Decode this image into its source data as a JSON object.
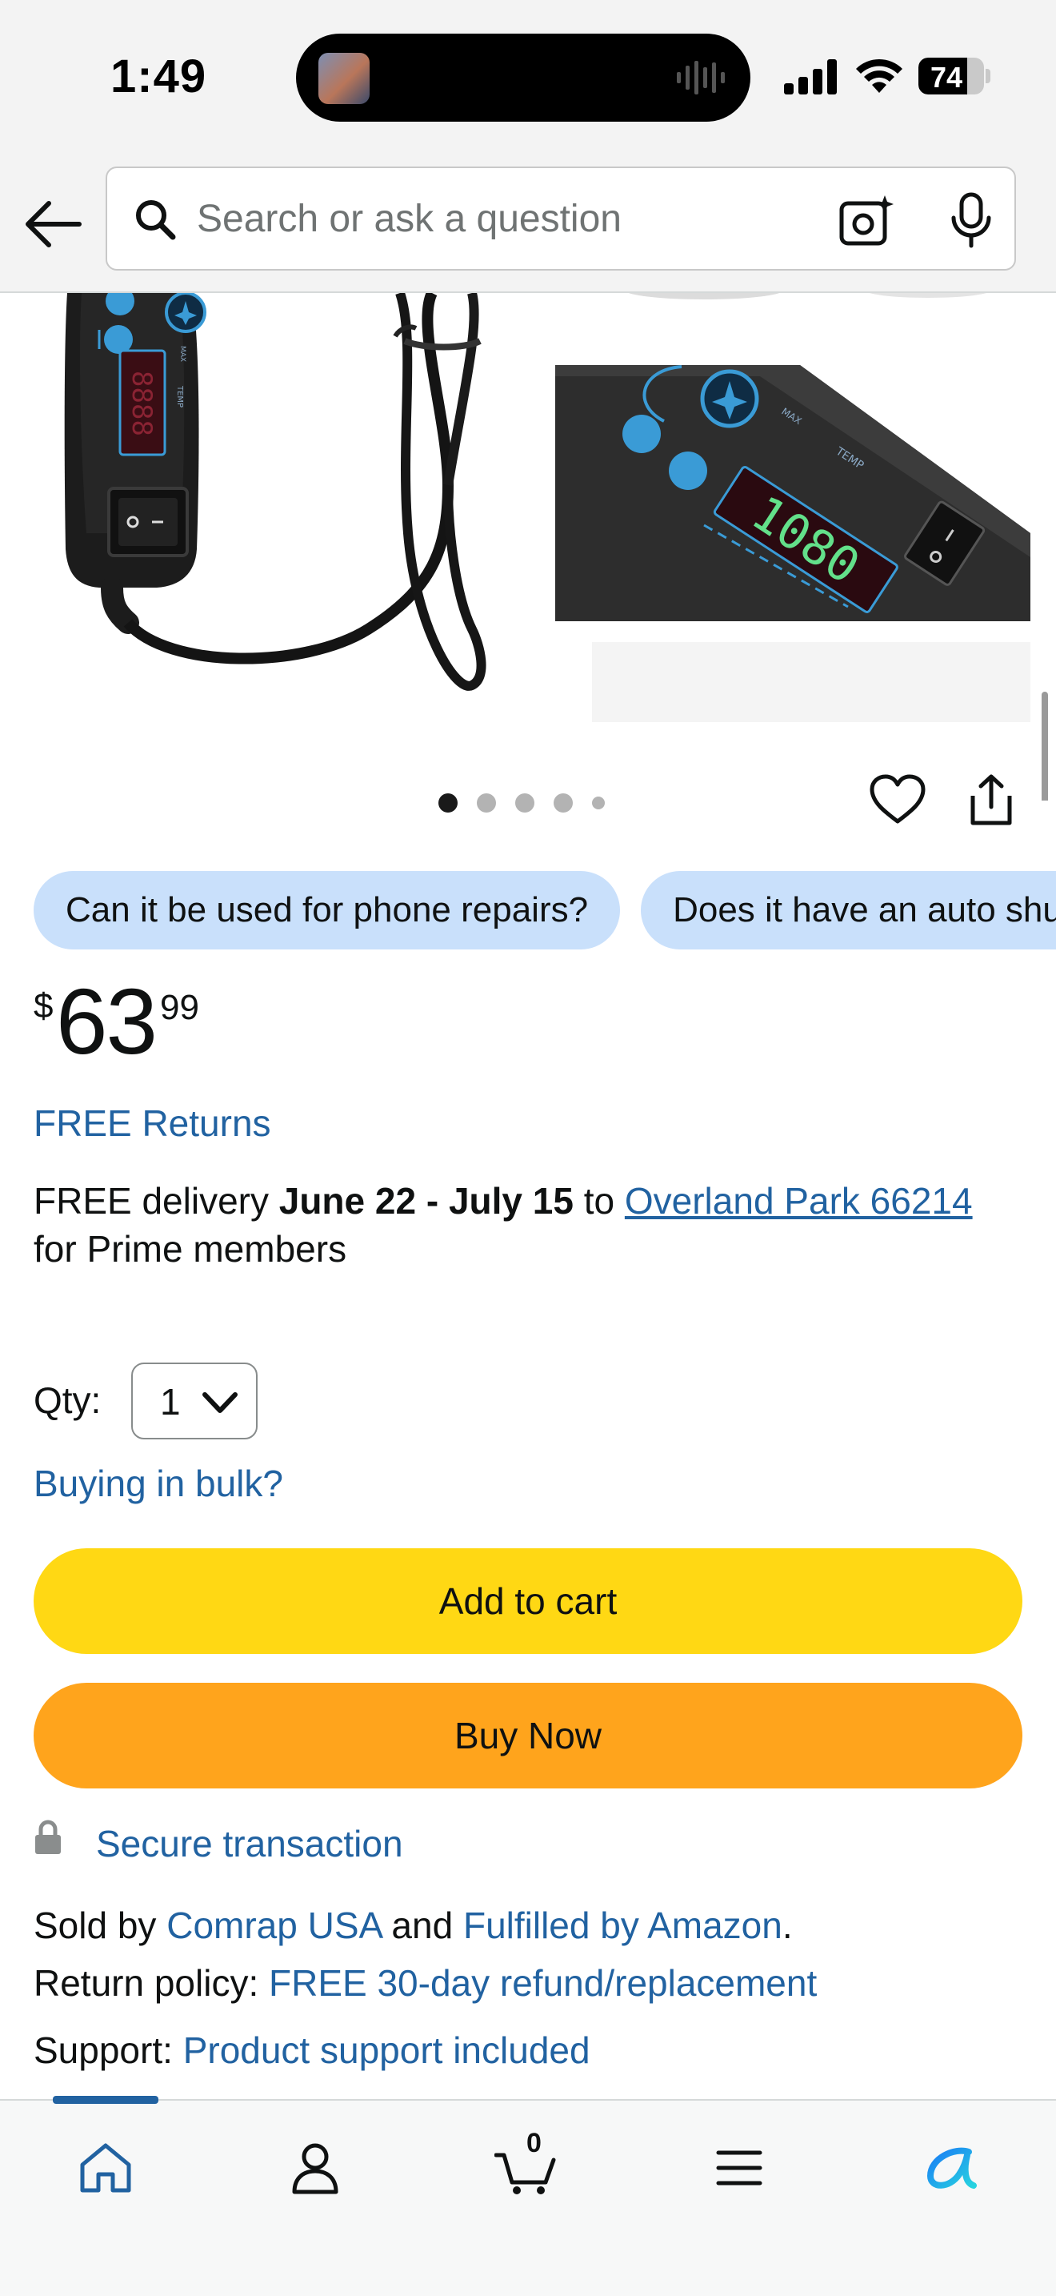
{
  "status_bar": {
    "time": "1:49",
    "battery_level": 74,
    "battery_text": "74"
  },
  "header": {
    "search_placeholder": "Search or ask a question",
    "icons": [
      "back-arrow-icon",
      "search-icon",
      "camera-lens-icon",
      "mic-icon"
    ]
  },
  "gallery": {
    "image_count": 5,
    "active_index": 0,
    "display_reading": "1080"
  },
  "questions": [
    "Can it be used for phone repairs?",
    "Does it have an auto shut-off?"
  ],
  "price": {
    "symbol": "$",
    "whole": "63",
    "fraction": "99"
  },
  "returns": {
    "label": "FREE Returns"
  },
  "delivery": {
    "prefix": "FREE delivery ",
    "dates": "June 22 - July 15",
    "middle": " to ",
    "location": "Overland Park 66214",
    "suffix": "for Prime members"
  },
  "quantity": {
    "label": "Qty:",
    "value": "1"
  },
  "bulk_link": "Buying in bulk?",
  "buttons": {
    "add_to_cart": "Add to cart",
    "buy_now": "Buy Now"
  },
  "secure": {
    "label": "Secure transaction"
  },
  "seller": {
    "sold_by_label": "Sold by ",
    "seller_name": "Comrap USA",
    "and": " and ",
    "fulfilled": "Fulfilled by Amazon",
    "period": ".",
    "return_label": "Return policy: ",
    "return_value": "FREE 30-day refund/replacement",
    "support_label": "Support: ",
    "support_value": "Product support included"
  },
  "bottom_nav": {
    "cart_count": "0",
    "active": "home",
    "items": [
      "home-icon",
      "account-icon",
      "cart-icon",
      "menu-icon",
      "rufus-icon"
    ]
  },
  "colors": {
    "link": "#2162a1",
    "add_to_cart": "#ffd814",
    "buy_now": "#ffa41c",
    "chip_bg": "#c9e0fb",
    "header_bg": "#f3f3f3"
  }
}
